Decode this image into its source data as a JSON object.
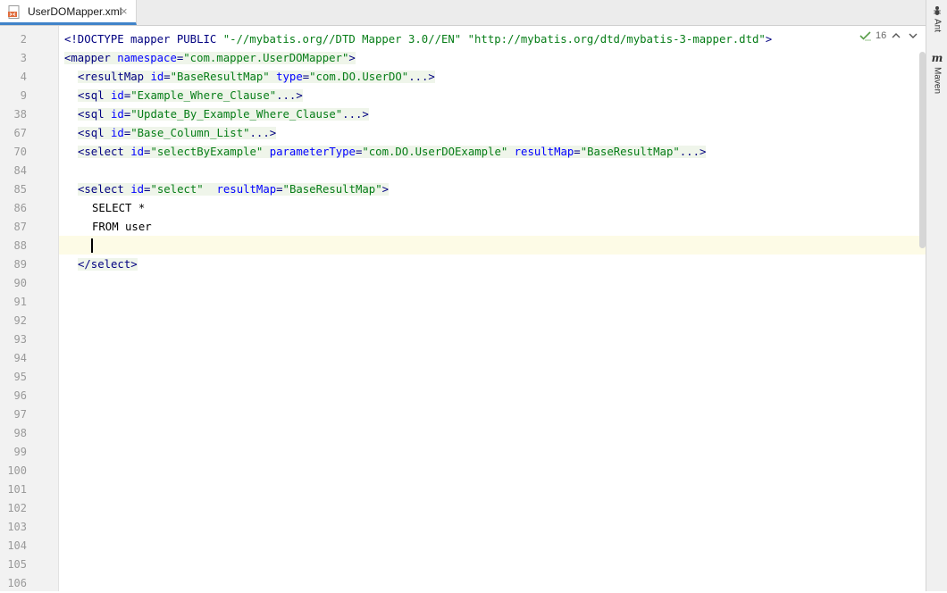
{
  "tab": {
    "label": "UserDOMapper.xml",
    "close": "×"
  },
  "inspection": {
    "count": "16"
  },
  "side_tools": [
    {
      "label": "Ant"
    },
    {
      "label": "Maven"
    }
  ],
  "line_numbers": [
    "2",
    "3",
    "4",
    "9",
    "38",
    "67",
    "70",
    "84",
    "85",
    "86",
    "87",
    "88",
    "89",
    "90",
    "91",
    "92",
    "93",
    "94",
    "95",
    "96",
    "97",
    "98",
    "99",
    "100",
    "101",
    "102",
    "103",
    "104",
    "105",
    "106"
  ],
  "code": {
    "l2": {
      "a": "<!DOCTYPE mapper PUBLIC ",
      "b": "\"-//mybatis.org//DTD Mapper 3.0//EN\"",
      "c": " ",
      "d": "\"http://mybatis.org/dtd/mybatis-3-mapper.dtd\"",
      "e": ">"
    },
    "l3": {
      "a": "<mapper ",
      "b": "namespace",
      "c": "=",
      "d": "\"com.mapper.UserDOMapper\"",
      "e": ">"
    },
    "l4": {
      "a": "<resultMap ",
      "b": "id",
      "c": "=",
      "d": "\"BaseResultMap\"",
      "e": " ",
      "f": "type",
      "g": "=",
      "h": "\"com.DO.UserDO\"",
      "i": "...>"
    },
    "l9": {
      "a": "<sql ",
      "b": "id",
      "c": "=",
      "d": "\"Example_Where_Clause\"",
      "e": "...>"
    },
    "l38": {
      "a": "<sql ",
      "b": "id",
      "c": "=",
      "d": "\"Update_By_Example_Where_Clause\"",
      "e": "...>"
    },
    "l67": {
      "a": "<sql ",
      "b": "id",
      "c": "=",
      "d": "\"Base_Column_List\"",
      "e": "...>"
    },
    "l70": {
      "a": "<select ",
      "b": "id",
      "c": "=",
      "d": "\"selectByExample\"",
      "e": " ",
      "f": "parameterType",
      "g": "=",
      "h": "\"com.DO.UserDOExample\"",
      "i": " ",
      "j": "resultMap",
      "k": "=",
      "l": "\"BaseResultMap\"",
      "m": "...>"
    },
    "l85": {
      "a": "<select ",
      "b": "id",
      "c": "=",
      "d": "\"select\"",
      "e": "  ",
      "f": "resultMap",
      "g": "=",
      "h": "\"BaseResultMap\"",
      "i": ">"
    },
    "l86": "SELECT *",
    "l87": "FROM user",
    "l89": "</select>"
  }
}
